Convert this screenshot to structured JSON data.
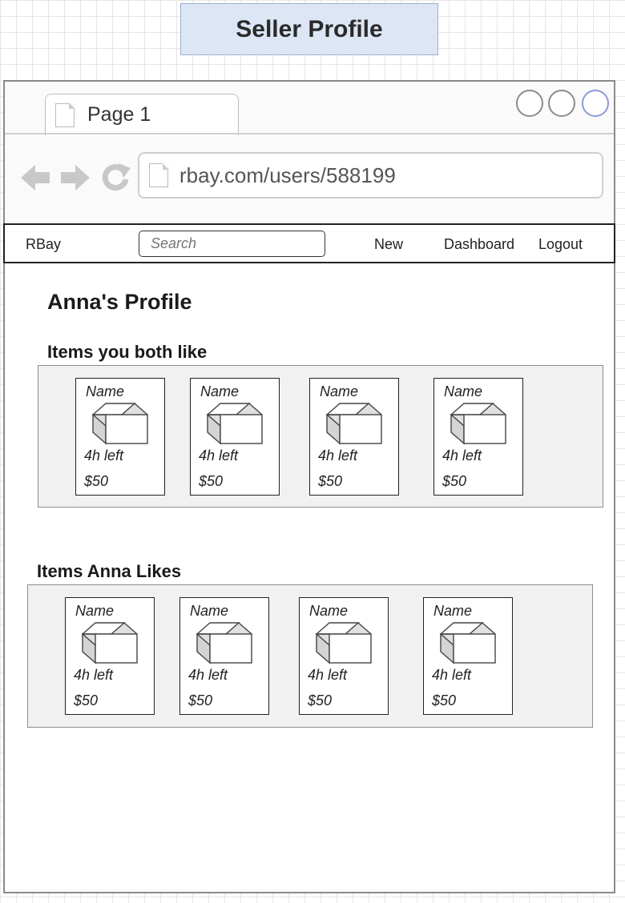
{
  "header": {
    "title": "Seller Profile"
  },
  "browser": {
    "tab_label": "Page 1",
    "url": "rbay.com/users/588199"
  },
  "appnav": {
    "brand": "RBay",
    "search_placeholder": "Search",
    "links": [
      "New",
      "Dashboard",
      "Logout"
    ]
  },
  "profile": {
    "title": "Anna's Profile",
    "sections": [
      {
        "heading": "Items you both like",
        "items": [
          {
            "name": "Name",
            "time_left": "4h left",
            "price": "$50"
          },
          {
            "name": "Name",
            "time_left": "4h left",
            "price": "$50"
          },
          {
            "name": "Name",
            "time_left": "4h left",
            "price": "$50"
          },
          {
            "name": "Name",
            "time_left": "4h left",
            "price": "$50"
          }
        ]
      },
      {
        "heading": "Items Anna Likes",
        "items": [
          {
            "name": "Name",
            "time_left": "4h left",
            "price": "$50"
          },
          {
            "name": "Name",
            "time_left": "4h left",
            "price": "$50"
          },
          {
            "name": "Name",
            "time_left": "4h left",
            "price": "$50"
          },
          {
            "name": "Name",
            "time_left": "4h left",
            "price": "$50"
          }
        ]
      }
    ]
  },
  "icons": {
    "tab": "document-icon",
    "url": "document-icon",
    "back": "back-arrow-icon",
    "forward": "forward-arrow-icon",
    "refresh": "refresh-icon",
    "item": "box-icon"
  },
  "colors": {
    "title_fill": "#dde6f5",
    "title_border": "#9fb0d0",
    "strip_fill": "#f1f1f1",
    "nav_icons": "#c8c8c8"
  }
}
